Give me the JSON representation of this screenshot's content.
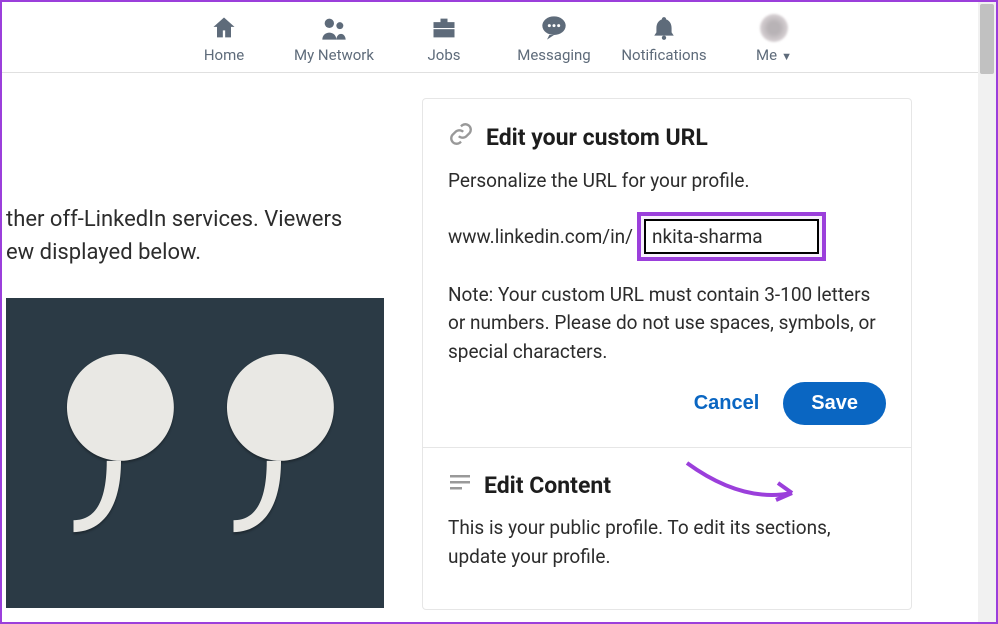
{
  "nav": {
    "home": "Home",
    "network": "My Network",
    "jobs": "Jobs",
    "messaging": "Messaging",
    "notifications": "Notifications",
    "me": "Me"
  },
  "left": {
    "line1": "ther off-LinkedIn services. Viewers",
    "line2": "ew displayed below."
  },
  "custom_url": {
    "title": "Edit your custom URL",
    "subtitle": "Personalize the URL for your profile.",
    "prefix": "www.linkedin.com/in/",
    "value": "nkita-sharma",
    "note": "Note: Your custom URL must contain 3-100 letters or numbers. Please do not use spaces, symbols, or special characters.",
    "cancel": "Cancel",
    "save": "Save"
  },
  "edit_content": {
    "title": "Edit Content",
    "body": "This is your public profile. To edit its sections, update your profile."
  }
}
